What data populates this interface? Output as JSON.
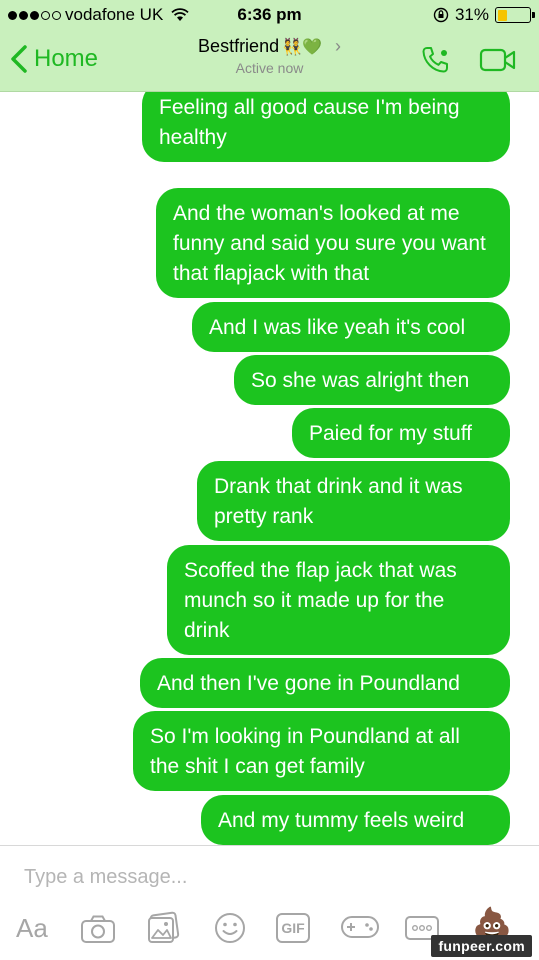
{
  "status_bar": {
    "carrier": "vodafone UK",
    "time": "6:36 pm",
    "battery_percent": "31%",
    "battery_level": 0.31,
    "battery_color": "#f5c400"
  },
  "header": {
    "back_label": "Home",
    "contact_name": "Bestfriend",
    "contact_emoji": "👯💚",
    "status": "Active now",
    "accent_color": "#1fb823"
  },
  "messages": [
    "Feeling all good cause I'm being healthy",
    "And the woman's looked at me funny and said you sure you want that flapjack with that",
    "And I was like yeah it's cool",
    "So she was alright then",
    "Paied for my stuff",
    "Drank that drink and it was pretty rank",
    "Scoffed the flap jack that was munch so it made up for the drink",
    "And then I've gone in Poundland",
    "So I'm looking in Poundland at all the shit I can get family",
    "And my tummy feels weird"
  ],
  "bubble_color": "#1cc41f",
  "composer": {
    "placeholder": "Type a message...",
    "aa_label": "Aa",
    "gif_label": "GIF",
    "emoji_icon": "💩"
  },
  "watermark": "funpeer.com"
}
